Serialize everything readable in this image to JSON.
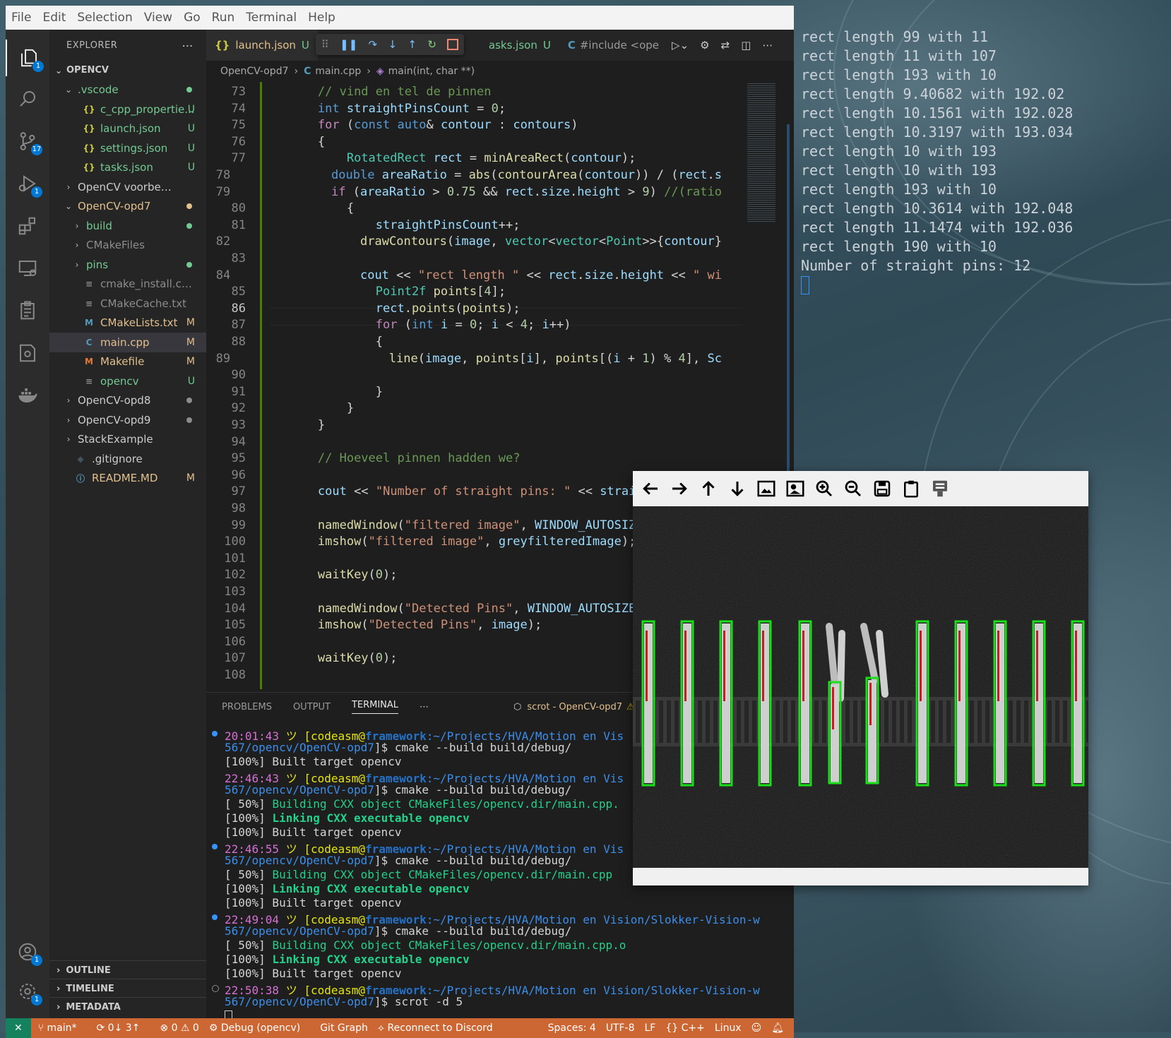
{
  "menu": [
    "File",
    "Edit",
    "Selection",
    "View",
    "Go",
    "Run",
    "Terminal",
    "Help"
  ],
  "activity_badges": {
    "explorer": "1",
    "scm": "17",
    "debug": "1",
    "accounts": "1",
    "manage": "1"
  },
  "explorer": {
    "title": "EXPLORER",
    "root": "OPENCV",
    "items": [
      {
        "label": ".vscode",
        "type": "folder-open",
        "status": "dot",
        "color": "#73c991"
      },
      {
        "label": "c_cpp_propertie...",
        "type": "json",
        "status": "U",
        "color": "#73c991",
        "indent": 2
      },
      {
        "label": "launch.json",
        "type": "json",
        "status": "U",
        "color": "#73c991",
        "indent": 2
      },
      {
        "label": "settings.json",
        "type": "json",
        "status": "U",
        "color": "#73c991",
        "indent": 2
      },
      {
        "label": "tasks.json",
        "type": "json",
        "status": "U",
        "color": "#73c991",
        "indent": 2
      },
      {
        "label": "OpenCV voorbeeld",
        "type": "folder",
        "status": "",
        "color": "#cccccc"
      },
      {
        "label": "OpenCV-opd7",
        "type": "folder-open",
        "status": "dot",
        "color": "#e2c08d"
      },
      {
        "label": "build",
        "type": "folder",
        "status": "dot",
        "color": "#73c991",
        "indent": 2
      },
      {
        "label": "CMakeFiles",
        "type": "folder",
        "status": "",
        "color": "#8c8c8c",
        "indent": 2
      },
      {
        "label": "pins",
        "type": "folder",
        "status": "dot",
        "color": "#73c991",
        "indent": 2
      },
      {
        "label": "cmake_install.cmake",
        "type": "text",
        "status": "",
        "color": "#8c8c8c",
        "indent": 2
      },
      {
        "label": "CMakeCache.txt",
        "type": "text",
        "status": "",
        "color": "#8c8c8c",
        "indent": 2
      },
      {
        "label": "CMakeLists.txt",
        "type": "cmake",
        "status": "M",
        "color": "#e2c08d",
        "indent": 2
      },
      {
        "label": "main.cpp",
        "type": "cpp",
        "status": "M",
        "color": "#e2c08d",
        "indent": 2,
        "selected": true
      },
      {
        "label": "Makefile",
        "type": "make",
        "status": "M",
        "color": "#e2c08d",
        "indent": 2
      },
      {
        "label": "opencv",
        "type": "text",
        "status": "U",
        "color": "#73c991",
        "indent": 2
      },
      {
        "label": "OpenCV-opd8",
        "type": "folder",
        "status": "dot",
        "color": "#cccccc"
      },
      {
        "label": "OpenCV-opd9",
        "type": "folder",
        "status": "dot",
        "color": "#cccccc"
      },
      {
        "label": "StackExample",
        "type": "folder",
        "status": "",
        "color": "#cccccc"
      },
      {
        "label": ".gitignore",
        "type": "git",
        "status": "",
        "color": "#cccccc"
      },
      {
        "label": "README.MD",
        "type": "info",
        "status": "M",
        "color": "#e2c08d"
      }
    ],
    "sections": [
      "OUTLINE",
      "TIMELINE",
      "METADATA"
    ]
  },
  "tabs": {
    "launch": "launch.json",
    "launch_status": "U",
    "tasks": "asks.json",
    "tasks_status": "U",
    "include": "#include <ope"
  },
  "breadcrumb": [
    "OpenCV-opd7",
    "main.cpp",
    "main(int, char **)"
  ],
  "code": [
    {
      "n": "73",
      "t": "        // vind en tel de pinnen"
    },
    {
      "n": "74",
      "t": "        int straightPinsCount = 0;"
    },
    {
      "n": "75",
      "t": "        for (const auto& contour : contours)"
    },
    {
      "n": "76",
      "t": "        {"
    },
    {
      "n": "77",
      "t": "            RotatedRect rect = minAreaRect(contour);"
    },
    {
      "n": "78",
      "t": "            double areaRatio = abs(contourArea(contour)) / (rect.s"
    },
    {
      "n": "79",
      "t": "            if (areaRatio > 0.75 && rect.size.height > 9) //(ratio"
    },
    {
      "n": "80",
      "t": "            {"
    },
    {
      "n": "81",
      "t": "                straightPinsCount++;"
    },
    {
      "n": "82",
      "t": "                drawContours(image, vector<vector<Point>>{contour}"
    },
    {
      "n": "83",
      "t": ""
    },
    {
      "n": "84",
      "t": "                cout << \"rect length \" << rect.size.height << \" wi"
    },
    {
      "n": "85",
      "t": "                Point2f points[4];"
    },
    {
      "n": "86",
      "t": "                rect.points(points);"
    },
    {
      "n": "87",
      "t": "                for (int i = 0; i < 4; i++)"
    },
    {
      "n": "88",
      "t": "                {"
    },
    {
      "n": "89",
      "t": "                    line(image, points[i], points[(i + 1) % 4], Sc"
    },
    {
      "n": "90",
      "t": ""
    },
    {
      "n": "91",
      "t": "                }"
    },
    {
      "n": "92",
      "t": "            }"
    },
    {
      "n": "93",
      "t": "        }"
    },
    {
      "n": "94",
      "t": ""
    },
    {
      "n": "95",
      "t": "        // Hoeveel pinnen hadden we?"
    },
    {
      "n": "96",
      "t": ""
    },
    {
      "n": "97",
      "t": "        cout << \"Number of straight pins: \" << straig"
    },
    {
      "n": "98",
      "t": ""
    },
    {
      "n": "99",
      "t": "        namedWindow(\"filtered image\", WINDOW_AUTOSIZE"
    },
    {
      "n": "100",
      "t": "        imshow(\"filtered image\", greyfilteredImage);"
    },
    {
      "n": "101",
      "t": ""
    },
    {
      "n": "102",
      "t": "        waitKey(0);"
    },
    {
      "n": "103",
      "t": ""
    },
    {
      "n": "104",
      "t": "        namedWindow(\"Detected Pins\", WINDOW_AUTOSIZE)"
    },
    {
      "n": "105",
      "t": "        imshow(\"Detected Pins\", image);"
    },
    {
      "n": "106",
      "t": ""
    },
    {
      "n": "107",
      "t": "        waitKey(0);"
    },
    {
      "n": "108",
      "t": ""
    }
  ],
  "panel": {
    "tabs": [
      "PROBLEMS",
      "OUTPUT",
      "TERMINAL"
    ],
    "task": "scrot - OpenCV-opd7",
    "lines": [
      {
        "dot": "blue",
        "time": "20:01:43",
        "rest": " ツ [codeasm@framework:~/Projects/HVA/Motion en Vis"
      },
      {
        "text": "567/opencv/OpenCV-opd7]$ cmake --build build/debug/"
      },
      {
        "text": "[100%] Built target opencv"
      },
      {
        "time": "22:46:43",
        "rest": " ツ [codeasm@framework:~/Projects/HVA/Motion en Vis"
      },
      {
        "text": "567/opencv/OpenCV-opd7]$ cmake --build build/debug/"
      },
      {
        "text": "[ 50%] Building CXX object CMakeFiles/opencv.dir/main.cpp."
      },
      {
        "text": "[100%] Linking CXX executable opencv"
      },
      {
        "text": "[100%] Built target opencv"
      },
      {
        "dot": "blue",
        "time": "22:46:55",
        "rest": " ツ [codeasm@framework:~/Projects/HVA/Motion en Vis"
      },
      {
        "text": "567/opencv/OpenCV-opd7]$ cmake --build build/debug/"
      },
      {
        "text": "[ 50%] Building CXX object CMakeFiles/opencv.dir/main.cpp"
      },
      {
        "text": "[100%] Linking CXX executable opencv"
      },
      {
        "text": "[100%] Built target opencv"
      },
      {
        "dot": "blue",
        "time": "22:49:04",
        "rest": " ツ [codeasm@framework:~/Projects/HVA/Motion en Vision/Slokker-Vision-w"
      },
      {
        "text": "567/opencv/OpenCV-opd7]$ cmake --build build/debug/"
      },
      {
        "text": "[ 50%] Building CXX object CMakeFiles/opencv.dir/main.cpp.o"
      },
      {
        "text": "[100%] Linking CXX executable opencv"
      },
      {
        "text": "[100%] Built target opencv"
      },
      {
        "dot": "hollow",
        "time": "22:50:38",
        "rest": " ツ [codeasm@framework:~/Projects/HVA/Motion en Vision/Slokker-Vision-w"
      },
      {
        "text": "567/opencv/OpenCV-opd7]$ scrot -d 5"
      }
    ]
  },
  "statusbar": {
    "branch": "main*",
    "sync": "0↓ 3↑",
    "problems": "⊗ 0 ⚠ 0",
    "debug": "Debug (opencv)",
    "gitgraph": "Git Graph",
    "discord": "Reconnect to Discord",
    "spaces": "Spaces: 4",
    "encoding": "UTF-8",
    "eol": "LF",
    "lang": "{} C++",
    "os": "Linux"
  },
  "output_terminal": [
    "rect length 99 with 11",
    "rect length 11 with 107",
    "rect length 193 with 10",
    "rect length 9.40682 with 192.02",
    "rect length 10.1561 with 192.028",
    "rect length 10.3197 with 193.034",
    "rect length 10 with 193",
    "rect length 10 with 193",
    "rect length 193 with 10",
    "rect length 10.3614 with 192.048",
    "rect length 11.1474 with 192.036",
    "rect length 190 with 10",
    "Number of straight pins: 12"
  ],
  "viewer_tools": [
    "pan-left-icon",
    "pan-right-icon",
    "pan-up-icon",
    "pan-down-icon",
    "zoom-fit-icon",
    "zoom-actual-icon",
    "zoom-in-icon",
    "zoom-out-icon",
    "save-icon",
    "copy-clipboard-icon",
    "properties-icon"
  ]
}
